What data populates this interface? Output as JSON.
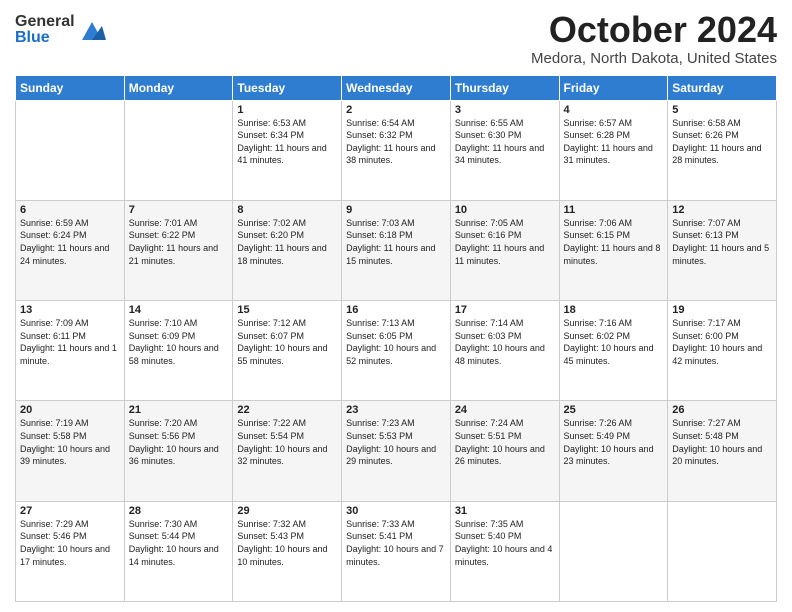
{
  "logo": {
    "general": "General",
    "blue": "Blue"
  },
  "header": {
    "month": "October 2024",
    "location": "Medora, North Dakota, United States"
  },
  "weekdays": [
    "Sunday",
    "Monday",
    "Tuesday",
    "Wednesday",
    "Thursday",
    "Friday",
    "Saturday"
  ],
  "weeks": [
    [
      {
        "day": "",
        "sunrise": "",
        "sunset": "",
        "daylight": ""
      },
      {
        "day": "",
        "sunrise": "",
        "sunset": "",
        "daylight": ""
      },
      {
        "day": "1",
        "sunrise": "Sunrise: 6:53 AM",
        "sunset": "Sunset: 6:34 PM",
        "daylight": "Daylight: 11 hours and 41 minutes."
      },
      {
        "day": "2",
        "sunrise": "Sunrise: 6:54 AM",
        "sunset": "Sunset: 6:32 PM",
        "daylight": "Daylight: 11 hours and 38 minutes."
      },
      {
        "day": "3",
        "sunrise": "Sunrise: 6:55 AM",
        "sunset": "Sunset: 6:30 PM",
        "daylight": "Daylight: 11 hours and 34 minutes."
      },
      {
        "day": "4",
        "sunrise": "Sunrise: 6:57 AM",
        "sunset": "Sunset: 6:28 PM",
        "daylight": "Daylight: 11 hours and 31 minutes."
      },
      {
        "day": "5",
        "sunrise": "Sunrise: 6:58 AM",
        "sunset": "Sunset: 6:26 PM",
        "daylight": "Daylight: 11 hours and 28 minutes."
      }
    ],
    [
      {
        "day": "6",
        "sunrise": "Sunrise: 6:59 AM",
        "sunset": "Sunset: 6:24 PM",
        "daylight": "Daylight: 11 hours and 24 minutes."
      },
      {
        "day": "7",
        "sunrise": "Sunrise: 7:01 AM",
        "sunset": "Sunset: 6:22 PM",
        "daylight": "Daylight: 11 hours and 21 minutes."
      },
      {
        "day": "8",
        "sunrise": "Sunrise: 7:02 AM",
        "sunset": "Sunset: 6:20 PM",
        "daylight": "Daylight: 11 hours and 18 minutes."
      },
      {
        "day": "9",
        "sunrise": "Sunrise: 7:03 AM",
        "sunset": "Sunset: 6:18 PM",
        "daylight": "Daylight: 11 hours and 15 minutes."
      },
      {
        "day": "10",
        "sunrise": "Sunrise: 7:05 AM",
        "sunset": "Sunset: 6:16 PM",
        "daylight": "Daylight: 11 hours and 11 minutes."
      },
      {
        "day": "11",
        "sunrise": "Sunrise: 7:06 AM",
        "sunset": "Sunset: 6:15 PM",
        "daylight": "Daylight: 11 hours and 8 minutes."
      },
      {
        "day": "12",
        "sunrise": "Sunrise: 7:07 AM",
        "sunset": "Sunset: 6:13 PM",
        "daylight": "Daylight: 11 hours and 5 minutes."
      }
    ],
    [
      {
        "day": "13",
        "sunrise": "Sunrise: 7:09 AM",
        "sunset": "Sunset: 6:11 PM",
        "daylight": "Daylight: 11 hours and 1 minute."
      },
      {
        "day": "14",
        "sunrise": "Sunrise: 7:10 AM",
        "sunset": "Sunset: 6:09 PM",
        "daylight": "Daylight: 10 hours and 58 minutes."
      },
      {
        "day": "15",
        "sunrise": "Sunrise: 7:12 AM",
        "sunset": "Sunset: 6:07 PM",
        "daylight": "Daylight: 10 hours and 55 minutes."
      },
      {
        "day": "16",
        "sunrise": "Sunrise: 7:13 AM",
        "sunset": "Sunset: 6:05 PM",
        "daylight": "Daylight: 10 hours and 52 minutes."
      },
      {
        "day": "17",
        "sunrise": "Sunrise: 7:14 AM",
        "sunset": "Sunset: 6:03 PM",
        "daylight": "Daylight: 10 hours and 48 minutes."
      },
      {
        "day": "18",
        "sunrise": "Sunrise: 7:16 AM",
        "sunset": "Sunset: 6:02 PM",
        "daylight": "Daylight: 10 hours and 45 minutes."
      },
      {
        "day": "19",
        "sunrise": "Sunrise: 7:17 AM",
        "sunset": "Sunset: 6:00 PM",
        "daylight": "Daylight: 10 hours and 42 minutes."
      }
    ],
    [
      {
        "day": "20",
        "sunrise": "Sunrise: 7:19 AM",
        "sunset": "Sunset: 5:58 PM",
        "daylight": "Daylight: 10 hours and 39 minutes."
      },
      {
        "day": "21",
        "sunrise": "Sunrise: 7:20 AM",
        "sunset": "Sunset: 5:56 PM",
        "daylight": "Daylight: 10 hours and 36 minutes."
      },
      {
        "day": "22",
        "sunrise": "Sunrise: 7:22 AM",
        "sunset": "Sunset: 5:54 PM",
        "daylight": "Daylight: 10 hours and 32 minutes."
      },
      {
        "day": "23",
        "sunrise": "Sunrise: 7:23 AM",
        "sunset": "Sunset: 5:53 PM",
        "daylight": "Daylight: 10 hours and 29 minutes."
      },
      {
        "day": "24",
        "sunrise": "Sunrise: 7:24 AM",
        "sunset": "Sunset: 5:51 PM",
        "daylight": "Daylight: 10 hours and 26 minutes."
      },
      {
        "day": "25",
        "sunrise": "Sunrise: 7:26 AM",
        "sunset": "Sunset: 5:49 PM",
        "daylight": "Daylight: 10 hours and 23 minutes."
      },
      {
        "day": "26",
        "sunrise": "Sunrise: 7:27 AM",
        "sunset": "Sunset: 5:48 PM",
        "daylight": "Daylight: 10 hours and 20 minutes."
      }
    ],
    [
      {
        "day": "27",
        "sunrise": "Sunrise: 7:29 AM",
        "sunset": "Sunset: 5:46 PM",
        "daylight": "Daylight: 10 hours and 17 minutes."
      },
      {
        "day": "28",
        "sunrise": "Sunrise: 7:30 AM",
        "sunset": "Sunset: 5:44 PM",
        "daylight": "Daylight: 10 hours and 14 minutes."
      },
      {
        "day": "29",
        "sunrise": "Sunrise: 7:32 AM",
        "sunset": "Sunset: 5:43 PM",
        "daylight": "Daylight: 10 hours and 10 minutes."
      },
      {
        "day": "30",
        "sunrise": "Sunrise: 7:33 AM",
        "sunset": "Sunset: 5:41 PM",
        "daylight": "Daylight: 10 hours and 7 minutes."
      },
      {
        "day": "31",
        "sunrise": "Sunrise: 7:35 AM",
        "sunset": "Sunset: 5:40 PM",
        "daylight": "Daylight: 10 hours and 4 minutes."
      },
      {
        "day": "",
        "sunrise": "",
        "sunset": "",
        "daylight": ""
      },
      {
        "day": "",
        "sunrise": "",
        "sunset": "",
        "daylight": ""
      }
    ]
  ]
}
